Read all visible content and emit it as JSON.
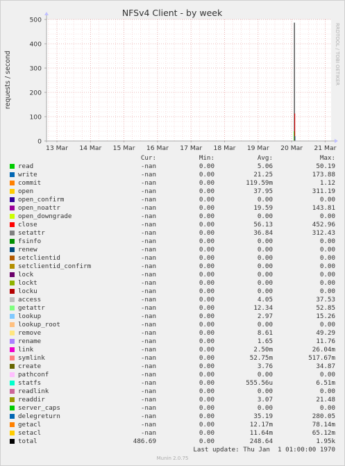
{
  "chart_data": {
    "type": "line",
    "title": "NFSv4 Client - by week",
    "ylabel": "requests / second",
    "watermark": "RRDTOOL / TOBI OETIKER",
    "ylim": [
      0,
      500
    ],
    "yticks": [
      "0",
      "100",
      "200",
      "300",
      "400",
      "500"
    ],
    "xticks": [
      "13 Mar",
      "14 Mar",
      "15 Mar",
      "16 Mar",
      "17 Mar",
      "18 Mar",
      "19 Mar",
      "20 Mar",
      "21 Mar"
    ],
    "spike": {
      "x": "20 Mar",
      "total_peak": 486.69,
      "close_peak": 113
    },
    "grid": true,
    "colors": {
      "background": "#f0f0f0",
      "plot_background": "#ffffff",
      "major_grid": "#e6a0a0",
      "minor_grid": "#f2c4c4",
      "axis": "#aaaaaa"
    }
  },
  "legend": {
    "headers": {
      "cur": "Cur:",
      "min": "Min:",
      "avg": "Avg:",
      "max": "Max:"
    },
    "rows": [
      {
        "name": "read",
        "color": "#00cc00",
        "cur": "-nan",
        "min": "0.00",
        "avg": "5.06",
        "max": "50.19"
      },
      {
        "name": "write",
        "color": "#0066b3",
        "cur": "-nan",
        "min": "0.00",
        "avg": "21.25",
        "max": "173.88"
      },
      {
        "name": "commit",
        "color": "#ff8000",
        "cur": "-nan",
        "min": "0.00",
        "avg": "119.59m",
        "max": "1.12"
      },
      {
        "name": "open",
        "color": "#ffcc00",
        "cur": "-nan",
        "min": "0.00",
        "avg": "37.95",
        "max": "311.19"
      },
      {
        "name": "open_confirm",
        "color": "#330099",
        "cur": "-nan",
        "min": "0.00",
        "avg": "0.00",
        "max": "0.00"
      },
      {
        "name": "open_noattr",
        "color": "#990099",
        "cur": "-nan",
        "min": "0.00",
        "avg": "19.59",
        "max": "143.81"
      },
      {
        "name": "open_downgrade",
        "color": "#ccff00",
        "cur": "-nan",
        "min": "0.00",
        "avg": "0.00",
        "max": "0.00"
      },
      {
        "name": "close",
        "color": "#ff0000",
        "cur": "-nan",
        "min": "0.00",
        "avg": "56.13",
        "max": "452.96"
      },
      {
        "name": "setattr",
        "color": "#808080",
        "cur": "-nan",
        "min": "0.00",
        "avg": "36.84",
        "max": "312.43"
      },
      {
        "name": "fsinfo",
        "color": "#008f00",
        "cur": "-nan",
        "min": "0.00",
        "avg": "0.00",
        "max": "0.00"
      },
      {
        "name": "renew",
        "color": "#00487d",
        "cur": "-nan",
        "min": "0.00",
        "avg": "0.00",
        "max": "0.00"
      },
      {
        "name": "setclientid",
        "color": "#b35a00",
        "cur": "-nan",
        "min": "0.00",
        "avg": "0.00",
        "max": "0.00"
      },
      {
        "name": "setclientid_confirm",
        "color": "#b38f00",
        "cur": "-nan",
        "min": "0.00",
        "avg": "0.00",
        "max": "0.00"
      },
      {
        "name": "lock",
        "color": "#6b006b",
        "cur": "-nan",
        "min": "0.00",
        "avg": "0.00",
        "max": "0.00"
      },
      {
        "name": "lockt",
        "color": "#8fb300",
        "cur": "-nan",
        "min": "0.00",
        "avg": "0.00",
        "max": "0.00"
      },
      {
        "name": "locku",
        "color": "#b30000",
        "cur": "-nan",
        "min": "0.00",
        "avg": "0.00",
        "max": "0.00"
      },
      {
        "name": "access",
        "color": "#bebebe",
        "cur": "-nan",
        "min": "0.00",
        "avg": "4.05",
        "max": "37.53"
      },
      {
        "name": "getattr",
        "color": "#80ff80",
        "cur": "-nan",
        "min": "0.00",
        "avg": "12.34",
        "max": "52.85"
      },
      {
        "name": "lookup",
        "color": "#80c9ff",
        "cur": "-nan",
        "min": "0.00",
        "avg": "2.97",
        "max": "15.26"
      },
      {
        "name": "lookup_root",
        "color": "#ffc080",
        "cur": "-nan",
        "min": "0.00",
        "avg": "0.00",
        "max": "0.00"
      },
      {
        "name": "remove",
        "color": "#ffe680",
        "cur": "-nan",
        "min": "0.00",
        "avg": "8.61",
        "max": "49.29"
      },
      {
        "name": "rename",
        "color": "#aa80ff",
        "cur": "-nan",
        "min": "0.00",
        "avg": "1.65",
        "max": "11.76"
      },
      {
        "name": "link",
        "color": "#ee00cc",
        "cur": "-nan",
        "min": "0.00",
        "avg": "2.50m",
        "max": "26.04m"
      },
      {
        "name": "symlink",
        "color": "#ff8080",
        "cur": "-nan",
        "min": "0.00",
        "avg": "52.75m",
        "max": "517.67m"
      },
      {
        "name": "create",
        "color": "#666600",
        "cur": "-nan",
        "min": "0.00",
        "avg": "3.76",
        "max": "34.87"
      },
      {
        "name": "pathconf",
        "color": "#ffbfff",
        "cur": "-nan",
        "min": "0.00",
        "avg": "0.00",
        "max": "0.00"
      },
      {
        "name": "statfs",
        "color": "#00ffcc",
        "cur": "-nan",
        "min": "0.00",
        "avg": "555.56u",
        "max": "6.51m"
      },
      {
        "name": "readlink",
        "color": "#cc6699",
        "cur": "-nan",
        "min": "0.00",
        "avg": "0.00",
        "max": "0.00"
      },
      {
        "name": "readdir",
        "color": "#999900",
        "cur": "-nan",
        "min": "0.00",
        "avg": "3.07",
        "max": "21.48"
      },
      {
        "name": "server_caps",
        "color": "#00cc00",
        "cur": "-nan",
        "min": "0.00",
        "avg": "0.00",
        "max": "0.00"
      },
      {
        "name": "delegreturn",
        "color": "#0066b3",
        "cur": "-nan",
        "min": "0.00",
        "avg": "35.19",
        "max": "280.05"
      },
      {
        "name": "getacl",
        "color": "#ff8000",
        "cur": "-nan",
        "min": "0.00",
        "avg": "12.17m",
        "max": "78.14m"
      },
      {
        "name": "setacl",
        "color": "#ffcc00",
        "cur": "-nan",
        "min": "0.00",
        "avg": "11.64m",
        "max": "65.12m"
      },
      {
        "name": "total",
        "color": "#000000",
        "cur": "486.69",
        "min": "0.00",
        "avg": "248.64",
        "max": "1.95k"
      }
    ]
  },
  "footer": {
    "last_update": "Last update: Thu Jan  1 01:00:00 1970",
    "version": "Munin 2.0.75"
  }
}
